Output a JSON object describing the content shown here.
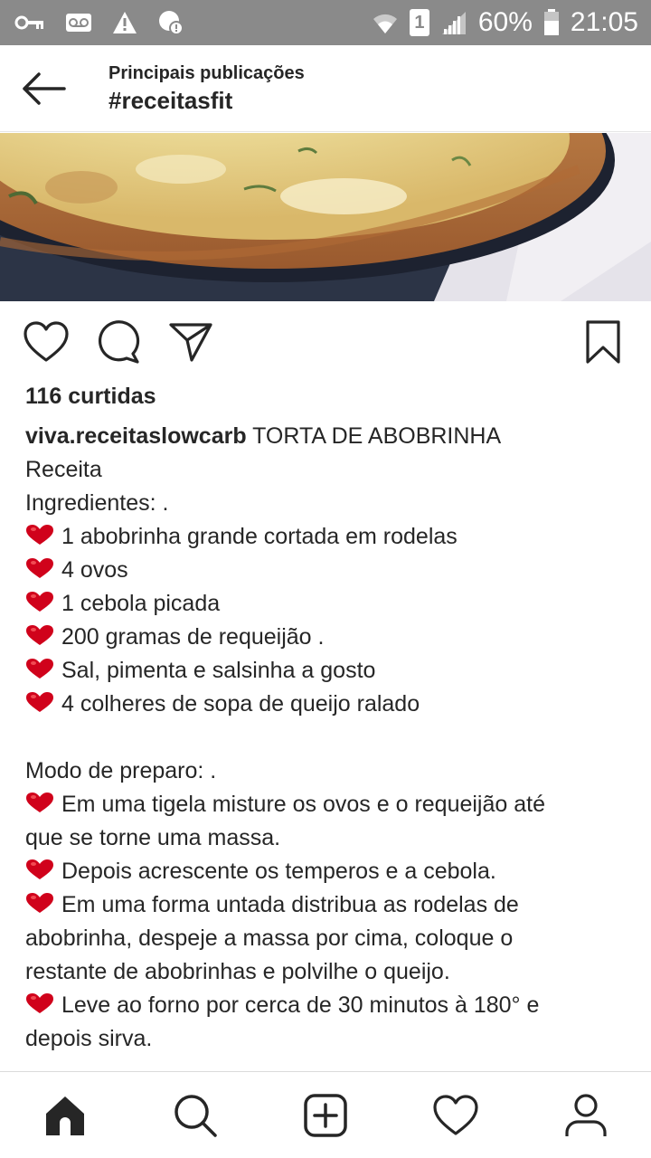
{
  "status_bar": {
    "battery_percent": "60%",
    "time": "21:05",
    "sim_slot": "1",
    "icons": [
      "key-icon",
      "voicemail-icon",
      "warning-icon",
      "chat-alert-icon",
      "wifi-icon",
      "sim-icon",
      "signal-icon",
      "battery-icon"
    ]
  },
  "header": {
    "subtitle": "Principais publicações",
    "title": "#receitasfit",
    "back_icon": "arrow-left-icon"
  },
  "post": {
    "image_description_icon": "photo",
    "actions": [
      "heart-icon",
      "comment-icon",
      "share-icon",
      "bookmark-icon"
    ],
    "likes": "116 curtidas",
    "username": "viva.receitaslowcarb",
    "caption_first": " TORTA DE ABOBRINHA",
    "lines": [
      {
        "heart": false,
        "text": "Receita"
      },
      {
        "heart": false,
        "text": "Ingredientes: ."
      },
      {
        "heart": true,
        "text": "1 abobrinha grande cortada em rodelas"
      },
      {
        "heart": true,
        "text": "4 ovos"
      },
      {
        "heart": true,
        "text": "1 cebola picada"
      },
      {
        "heart": true,
        "text": "200 gramas de requeijão ."
      },
      {
        "heart": true,
        "text": "Sal, pimenta e salsinha a gosto"
      },
      {
        "heart": true,
        "text": "4 colheres de sopa de queijo ralado"
      },
      {
        "heart": false,
        "text": ""
      },
      {
        "heart": false,
        "text": "Modo de preparo: ."
      },
      {
        "heart": true,
        "text": "Em uma tigela misture os ovos e o requeijão até"
      },
      {
        "heart": false,
        "text": "que se torne uma massa."
      },
      {
        "heart": true,
        "text": "Depois acrescente os temperos e a cebola."
      },
      {
        "heart": true,
        "text": "Em uma forma untada distribua as rodelas de"
      },
      {
        "heart": false,
        "text": "abobrinha, despeje a massa por cima, coloque o"
      },
      {
        "heart": false,
        "text": "restante de abobrinhas e polvilhe o queijo."
      },
      {
        "heart": true,
        "text": "Leve ao forno por cerca de 30 minutos à 180° e"
      },
      {
        "heart": false,
        "text": "depois sirva."
      }
    ]
  },
  "bottom_nav": [
    "home-icon",
    "search-icon",
    "new-post-icon",
    "activity-heart-icon",
    "profile-icon"
  ],
  "colors": {
    "status_bar": "#8a8a8a",
    "text": "#262626",
    "heart_emoji": "#d0021b"
  }
}
